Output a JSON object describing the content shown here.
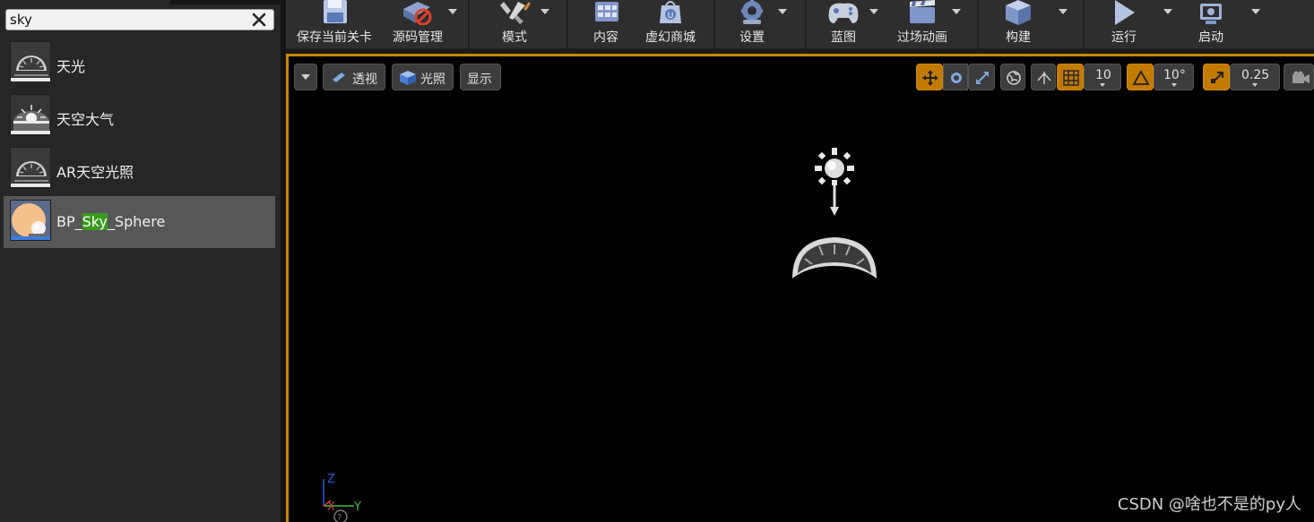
{
  "search": {
    "value": "sky",
    "clear_icon": "close-icon"
  },
  "results": [
    {
      "label": "天光",
      "icon": "skylight-icon",
      "selected": false
    },
    {
      "label": "天空大气",
      "icon": "sky-atmosphere-icon",
      "selected": false
    },
    {
      "label": "AR天空光照",
      "icon": "ar-skylight-icon",
      "selected": false
    },
    {
      "label_before": "BP_",
      "label_match": "Sky",
      "label_after": "_Sphere",
      "icon": "sky-sphere-icon",
      "selected": true
    }
  ],
  "toolbar": [
    {
      "label": "保存当前关卡",
      "icon": "save-icon"
    },
    {
      "label": "源码管理",
      "icon": "source-control-icon"
    },
    {
      "label": "模式",
      "icon": "modes-icon"
    },
    {
      "label": "内容",
      "icon": "content-icon"
    },
    {
      "label": "虚幻商城",
      "icon": "marketplace-icon"
    },
    {
      "label": "设置",
      "icon": "settings-icon"
    },
    {
      "label": "蓝图",
      "icon": "blueprint-icon"
    },
    {
      "label": "过场动画",
      "icon": "cinematics-icon"
    },
    {
      "label": "构建",
      "icon": "build-icon"
    },
    {
      "label": "运行",
      "icon": "play-icon"
    },
    {
      "label": "启动",
      "icon": "launch-icon"
    }
  ],
  "viewport": {
    "perspective": "透视",
    "lit": "光照",
    "show": "显示",
    "grid_snap": "10",
    "rotation_snap": "10°",
    "scale_snap": "0.25",
    "accent_color": "#c68a00"
  },
  "axis": {
    "z": "Z",
    "x": "X",
    "y": "Y"
  },
  "watermark": "CSDN @啥也不是的py人"
}
